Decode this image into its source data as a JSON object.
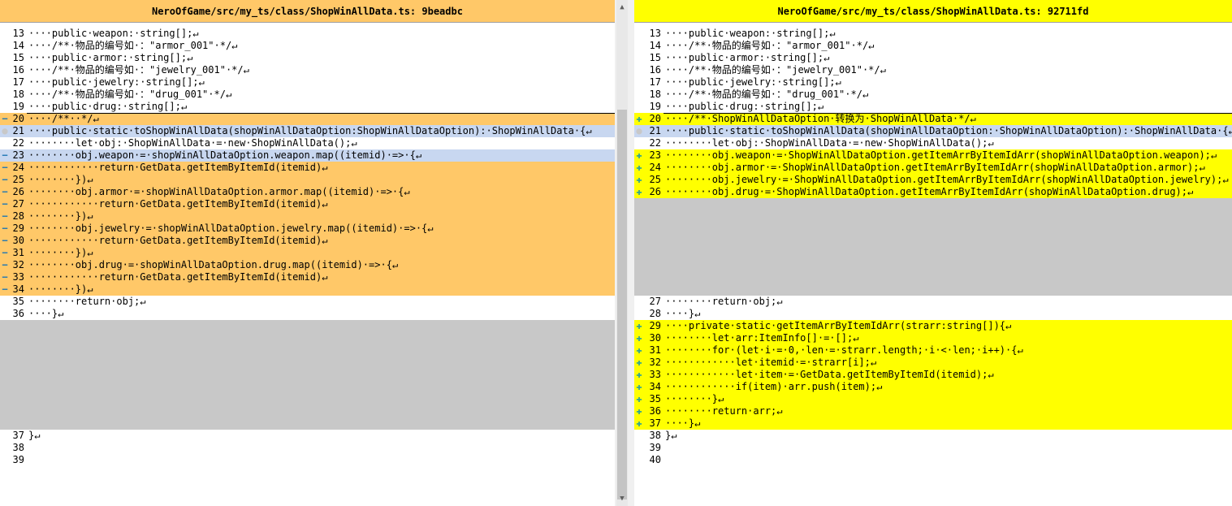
{
  "left": {
    "title": "NeroOfGame/src/my_ts/class/ShopWinAllData.ts: 9beadbc",
    "rows": [
      {
        "n": "13",
        "mark": "",
        "bg": "",
        "t": "····public·weapon:·string[];↵"
      },
      {
        "n": "14",
        "mark": "",
        "bg": "",
        "t": "····/**·物品的编号如·：\"armor_001\"·*/↵"
      },
      {
        "n": "15",
        "mark": "",
        "bg": "",
        "t": "····public·armor:·string[];↵"
      },
      {
        "n": "16",
        "mark": "",
        "bg": "",
        "t": "····/**·物品的编号如·：\"jewelry_001\"·*/↵"
      },
      {
        "n": "17",
        "mark": "",
        "bg": "",
        "t": "····public·jewelry:·string[];↵"
      },
      {
        "n": "18",
        "mark": "",
        "bg": "",
        "t": "····/**·物品的编号如·：\"drug_001\"·*/↵"
      },
      {
        "n": "19",
        "mark": "",
        "bg": "",
        "t": "····public·drug:·string[];↵"
      },
      {
        "n": "20",
        "mark": "minus",
        "bg": "orange",
        "t": "····/**··*/↵"
      },
      {
        "n": "21",
        "mark": "dot",
        "bg": "sel",
        "t": "····public·static·toShopWinAllData(shopWinAllDataOption:ShopWinAllDataOption):·ShopWinAllData·{↵"
      },
      {
        "n": "22",
        "mark": "",
        "bg": "",
        "t": "········let·obj:·ShopWinAllData·=·new·ShopWinAllData();↵"
      },
      {
        "n": "23",
        "mark": "minus",
        "bg": "sel",
        "t": "········obj.weapon·=·shopWinAllDataOption.weapon.map((itemid)·=>·{↵"
      },
      {
        "n": "24",
        "mark": "minus",
        "bg": "orange",
        "t": "············return·GetData.getItemByItemId(itemid)↵"
      },
      {
        "n": "25",
        "mark": "minus",
        "bg": "orange",
        "t": "········})↵"
      },
      {
        "n": "26",
        "mark": "minus",
        "bg": "orange",
        "t": "········obj.armor·=·shopWinAllDataOption.armor.map((itemid)·=>·{↵"
      },
      {
        "n": "27",
        "mark": "minus",
        "bg": "orange",
        "t": "············return·GetData.getItemByItemId(itemid)↵"
      },
      {
        "n": "28",
        "mark": "minus",
        "bg": "orange",
        "t": "········})↵"
      },
      {
        "n": "29",
        "mark": "minus",
        "bg": "orange",
        "t": "········obj.jewelry·=·shopWinAllDataOption.jewelry.map((itemid)·=>·{↵"
      },
      {
        "n": "30",
        "mark": "minus",
        "bg": "orange",
        "t": "············return·GetData.getItemByItemId(itemid)↵"
      },
      {
        "n": "31",
        "mark": "minus",
        "bg": "orange",
        "t": "········})↵"
      },
      {
        "n": "32",
        "mark": "minus",
        "bg": "orange",
        "t": "········obj.drug·=·shopWinAllDataOption.drug.map((itemid)·=>·{↵"
      },
      {
        "n": "33",
        "mark": "minus",
        "bg": "orange",
        "t": "············return·GetData.getItemByItemId(itemid)↵"
      },
      {
        "n": "34",
        "mark": "minus",
        "bg": "orange",
        "t": "········})↵"
      },
      {
        "n": "35",
        "mark": "",
        "bg": "",
        "t": "········return·obj;↵"
      },
      {
        "n": "36",
        "mark": "",
        "bg": "",
        "t": "····}↵"
      },
      {
        "n": "",
        "mark": "",
        "bg": "gray",
        "t": ""
      },
      {
        "n": "",
        "mark": "",
        "bg": "gray",
        "t": ""
      },
      {
        "n": "",
        "mark": "",
        "bg": "gray",
        "t": ""
      },
      {
        "n": "",
        "mark": "",
        "bg": "gray",
        "t": ""
      },
      {
        "n": "",
        "mark": "",
        "bg": "gray",
        "t": ""
      },
      {
        "n": "",
        "mark": "",
        "bg": "gray",
        "t": ""
      },
      {
        "n": "",
        "mark": "",
        "bg": "gray",
        "t": ""
      },
      {
        "n": "",
        "mark": "",
        "bg": "gray",
        "t": ""
      },
      {
        "n": "",
        "mark": "",
        "bg": "gray",
        "t": ""
      },
      {
        "n": "37",
        "mark": "",
        "bg": "",
        "t": "}↵"
      },
      {
        "n": "38",
        "mark": "",
        "bg": "",
        "t": ""
      },
      {
        "n": "39",
        "mark": "",
        "bg": "",
        "t": ""
      }
    ]
  },
  "right": {
    "title": "NeroOfGame/src/my_ts/class/ShopWinAllData.ts: 92711fd",
    "rows": [
      {
        "n": "13",
        "mark": "",
        "bg": "",
        "t": "····public·weapon:·string[];↵"
      },
      {
        "n": "14",
        "mark": "",
        "bg": "",
        "t": "····/**·物品的编号如·：\"armor_001\"·*/↵"
      },
      {
        "n": "15",
        "mark": "",
        "bg": "",
        "t": "····public·armor:·string[];↵"
      },
      {
        "n": "16",
        "mark": "",
        "bg": "",
        "t": "····/**·物品的编号如·：\"jewelry_001\"·*/↵"
      },
      {
        "n": "17",
        "mark": "",
        "bg": "",
        "t": "····public·jewelry:·string[];↵"
      },
      {
        "n": "18",
        "mark": "",
        "bg": "",
        "t": "····/**·物品的编号如·：\"drug_001\"·*/↵"
      },
      {
        "n": "19",
        "mark": "",
        "bg": "",
        "t": "····public·drug:·string[];↵"
      },
      {
        "n": "20",
        "mark": "plus",
        "bg": "yellow",
        "t": "····/**·ShopWinAllDataOption·转换为·ShopWinAllData·*/↵"
      },
      {
        "n": "21",
        "mark": "dot",
        "bg": "sel",
        "t": "····public·static·toShopWinAllData(shopWinAllDataOption:·ShopWinAllDataOption):·ShopWinAllData·{↵"
      },
      {
        "n": "22",
        "mark": "",
        "bg": "",
        "t": "········let·obj:·ShopWinAllData·=·new·ShopWinAllData();↵"
      },
      {
        "n": "23",
        "mark": "plus",
        "bg": "yellow",
        "t": "········obj.weapon·=·ShopWinAllDataOption.getItemArrByItemIdArr(shopWinAllDataOption.weapon);↵"
      },
      {
        "n": "24",
        "mark": "plus",
        "bg": "yellow",
        "t": "········obj.armor·=·ShopWinAllDataOption.getItemArrByItemIdArr(shopWinAllDataOption.armor);↵"
      },
      {
        "n": "25",
        "mark": "plus",
        "bg": "yellow",
        "t": "········obj.jewelry·=·ShopWinAllDataOption.getItemArrByItemIdArr(shopWinAllDataOption.jewelry);↵"
      },
      {
        "n": "26",
        "mark": "plus",
        "bg": "yellow",
        "t": "········obj.drug·=·ShopWinAllDataOption.getItemArrByItemIdArr(shopWinAllDataOption.drug);↵"
      },
      {
        "n": "",
        "mark": "",
        "bg": "gray",
        "t": ""
      },
      {
        "n": "",
        "mark": "",
        "bg": "gray",
        "t": ""
      },
      {
        "n": "",
        "mark": "",
        "bg": "gray",
        "t": ""
      },
      {
        "n": "",
        "mark": "",
        "bg": "gray",
        "t": ""
      },
      {
        "n": "",
        "mark": "",
        "bg": "gray",
        "t": ""
      },
      {
        "n": "",
        "mark": "",
        "bg": "gray",
        "t": ""
      },
      {
        "n": "",
        "mark": "",
        "bg": "gray",
        "t": ""
      },
      {
        "n": "",
        "mark": "",
        "bg": "gray",
        "t": ""
      },
      {
        "n": "27",
        "mark": "",
        "bg": "",
        "t": "········return·obj;↵"
      },
      {
        "n": "28",
        "mark": "",
        "bg": "",
        "t": "····}↵"
      },
      {
        "n": "29",
        "mark": "plus",
        "bg": "yellow",
        "t": "····private·static·getItemArrByItemIdArr(strarr:string[]){↵"
      },
      {
        "n": "30",
        "mark": "plus",
        "bg": "yellow",
        "t": "········let·arr:ItemInfo[]·=·[];↵"
      },
      {
        "n": "31",
        "mark": "plus",
        "bg": "yellow",
        "t": "········for·(let·i·=·0,·len·=·strarr.length;·i·<·len;·i++)·{↵"
      },
      {
        "n": "32",
        "mark": "plus",
        "bg": "yellow",
        "t": "············let·itemid·=·strarr[i];↵"
      },
      {
        "n": "33",
        "mark": "plus",
        "bg": "yellow",
        "t": "············let·item·=·GetData.getItemByItemId(itemid);↵"
      },
      {
        "n": "34",
        "mark": "plus",
        "bg": "yellow",
        "t": "············if(item)·arr.push(item);↵"
      },
      {
        "n": "35",
        "mark": "plus",
        "bg": "yellow",
        "t": "········}↵"
      },
      {
        "n": "36",
        "mark": "plus",
        "bg": "yellow",
        "t": "········return·arr;↵"
      },
      {
        "n": "37",
        "mark": "plus",
        "bg": "yellow",
        "t": "····}↵"
      },
      {
        "n": "38",
        "mark": "",
        "bg": "",
        "t": "}↵"
      },
      {
        "n": "39",
        "mark": "",
        "bg": "",
        "t": ""
      },
      {
        "n": "40",
        "mark": "",
        "bg": "",
        "t": ""
      }
    ]
  },
  "colors": {
    "removed": "#ffc868",
    "added": "#ffff00",
    "filler": "#c8c8c8",
    "changed_line": "#c8d7f0",
    "inline_removed": "#d26464"
  },
  "markers": {
    "minus": "−",
    "plus": "✚",
    "dot": "●"
  }
}
